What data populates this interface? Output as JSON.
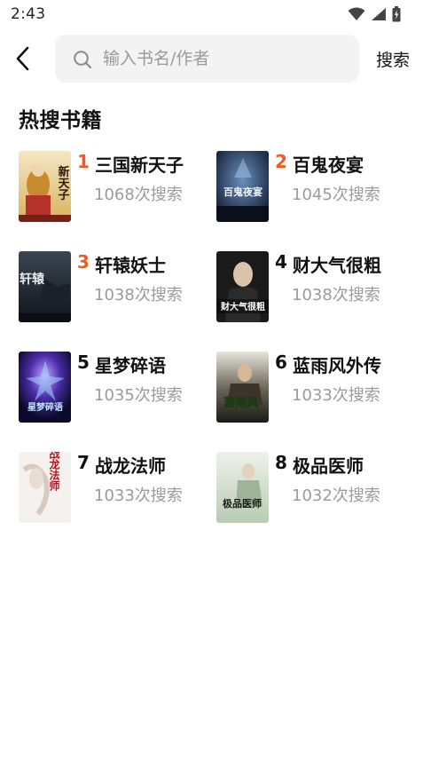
{
  "status_bar": {
    "time": "2:43"
  },
  "search": {
    "placeholder": "输入书名/作者",
    "button_label": "搜索"
  },
  "section_title": "热搜书籍",
  "colors": {
    "rank_highlight": "#f15a22",
    "rank_normal": "#111111",
    "count_text": "#9b9b9b",
    "search_bg": "#f3f3f3"
  },
  "books": [
    {
      "rank": "1",
      "title": "三国新天子",
      "count": "1068次搜索",
      "cover_text": "新天子"
    },
    {
      "rank": "2",
      "title": "百鬼夜宴",
      "count": "1045次搜索",
      "cover_text": "百鬼夜宴"
    },
    {
      "rank": "3",
      "title": "轩辕妖士",
      "count": "1038次搜索",
      "cover_text": "轩辕"
    },
    {
      "rank": "4",
      "title": "财大气很粗",
      "count": "1038次搜索",
      "cover_text": "财大气很粗"
    },
    {
      "rank": "5",
      "title": "星梦碎语",
      "count": "1035次搜索",
      "cover_text": "星梦碎语"
    },
    {
      "rank": "6",
      "title": "蓝雨风外传",
      "count": "1033次搜索",
      "cover_text": "蓝雨风"
    },
    {
      "rank": "7",
      "title": "战龙法师",
      "count": "1033次搜索",
      "cover_text": "战龙法师"
    },
    {
      "rank": "8",
      "title": "极品医师",
      "count": "1032次搜索",
      "cover_text": "极品医师"
    }
  ]
}
